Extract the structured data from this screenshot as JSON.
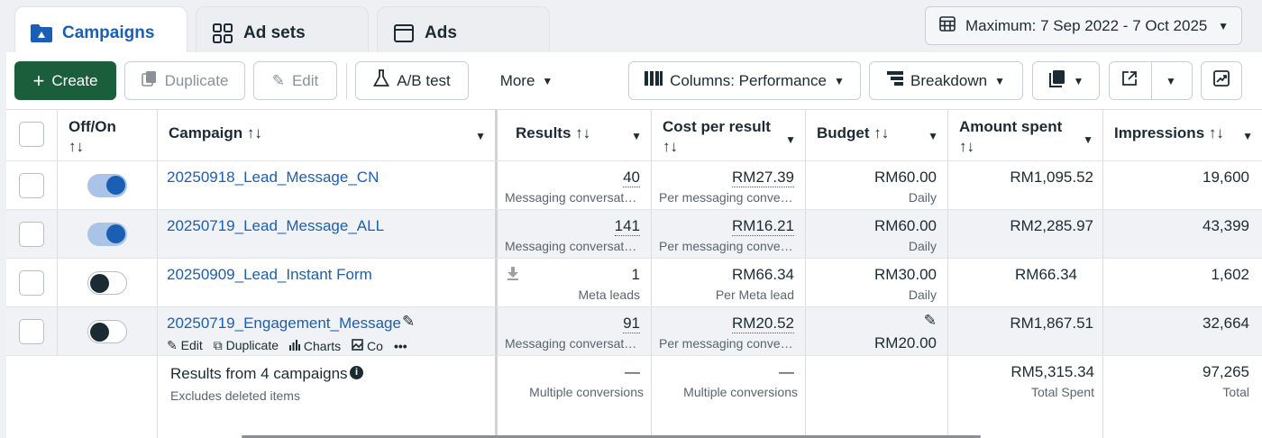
{
  "tabs": [
    {
      "label": "Campaigns"
    },
    {
      "label": "Ad sets"
    },
    {
      "label": "Ads"
    }
  ],
  "date_range": "Maximum: 7 Sep 2022 - 7 Oct 2025",
  "toolbar": {
    "create": "Create",
    "duplicate": "Duplicate",
    "edit": "Edit",
    "ab_test": "A/B test",
    "more": "More",
    "columns": "Columns: Performance",
    "breakdown": "Breakdown"
  },
  "headers": {
    "offon": "Off/On",
    "campaign": "Campaign",
    "results": "Results",
    "cost": "Cost per result",
    "budget": "Budget",
    "amount": "Amount spent",
    "impressions": "Impressions",
    "sort": "↑↓"
  },
  "rows": [
    {
      "name": "20250918_Lead_Message_CN",
      "on": true,
      "results": "40",
      "results_sub": "Messaging conversat…",
      "cost": "RM27.39",
      "cost_sub": "Per messaging conve…",
      "budget": "RM60.00",
      "budget_sub": "Daily",
      "spent": "RM1,095.52",
      "impressions": "19,600"
    },
    {
      "name": "20250719_Lead_Message_ALL",
      "on": true,
      "results": "141",
      "results_sub": "Messaging conversat…",
      "cost": "RM16.21",
      "cost_sub": "Per messaging conve…",
      "budget": "RM60.00",
      "budget_sub": "Daily",
      "spent": "RM2,285.97",
      "impressions": "43,399"
    },
    {
      "name": "20250909_Lead_Instant Form",
      "on": false,
      "results": "1",
      "results_sub": "Meta leads",
      "cost": "RM66.34",
      "cost_sub": "Per Meta lead",
      "budget": "RM30.00",
      "budget_sub": "Daily",
      "spent": "RM66.34",
      "impressions": "1,602"
    },
    {
      "name": "20250719_Engagement_Message",
      "on": false,
      "results": "91",
      "results_sub": "Messaging conversat…",
      "cost": "RM20.52",
      "cost_sub": "Per messaging conve…",
      "budget": "RM20.00",
      "budget_sub": "",
      "spent": "RM1,867.51",
      "impressions": "32,664"
    }
  ],
  "row_actions": {
    "edit": "Edit",
    "duplicate": "Duplicate",
    "charts": "Charts",
    "compare": "Co"
  },
  "summary": {
    "title": "Results from 4 campaigns",
    "note": "Excludes deleted items",
    "results": "—",
    "results_sub": "Multiple conversions",
    "cost": "—",
    "cost_sub": "Multiple conversions",
    "spent": "RM5,315.34",
    "spent_sub": "Total Spent",
    "impressions": "97,265",
    "impressions_sub": "Total"
  }
}
